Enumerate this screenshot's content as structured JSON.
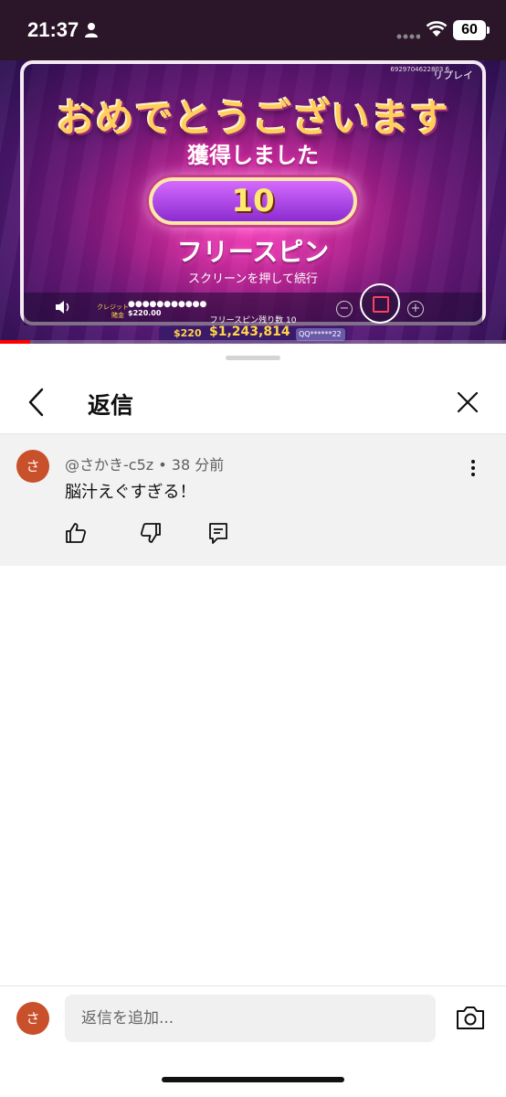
{
  "status_bar": {
    "time": "21:37",
    "battery": "60",
    "icons": [
      "person-icon",
      "signal-icon",
      "wifi-icon",
      "battery-icon"
    ]
  },
  "video": {
    "game_id": "6929704622803 6",
    "replay_label": "リプレイ",
    "congrats": "おめでとうございます",
    "won_label": "獲得しました",
    "free_spin_count": "10",
    "free_spin_label": "フリースピン",
    "press_screen": "スクリーンを押して続行",
    "credit_label": "クレジット",
    "credit_value": "●●●●●●●●●●●",
    "bet_label": "賭金",
    "bet_value": "$220.00",
    "remaining_label": "フリースピン残り数 10",
    "win_bet": "$220",
    "win_total": "$1,243,814",
    "win_user": "QQ******22",
    "progress": 0.06,
    "colors": {
      "progress": "#ff0000",
      "accent": "#ff3fb5"
    }
  },
  "sheet": {
    "title": "返信",
    "comment": {
      "avatar_letter": "さ",
      "meta": "@さかき-c5z • 38 分前",
      "text": "脳汁えぐすぎる！"
    },
    "reply": {
      "avatar_letter": "さ",
      "placeholder": "返信を追加..."
    },
    "avatar_color": "#c8502a"
  }
}
